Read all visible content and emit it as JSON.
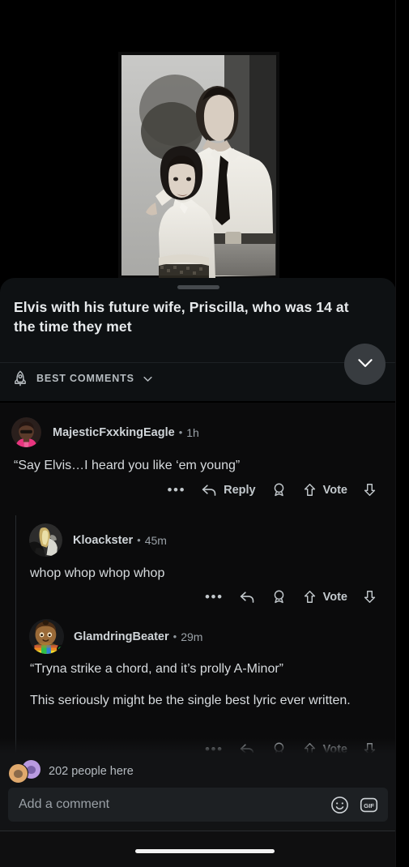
{
  "post": {
    "title": "Elvis with his future wife, Priscilla, who was 14 at the time they met",
    "media_alt": "Black and white photo of Elvis Presley with young Priscilla",
    "grabber_name": "drag-handle"
  },
  "sort": {
    "label": "BEST COMMENTS",
    "icon": "rocket-icon",
    "chevron": "chevron-down-icon"
  },
  "collapse": {
    "icon": "chevron-down-icon",
    "label": "Collapse post"
  },
  "actions": {
    "overflow": "•••",
    "reply": "Reply",
    "vote": "Vote",
    "award_icon": "award-ribbon-icon",
    "upvote_icon": "upvote-arrow-icon",
    "downvote_icon": "downvote-arrow-icon",
    "reply_icon": "reply-arrow-icon"
  },
  "comments": [
    {
      "id": "comment-1",
      "username": "MajesticFxxkingEagle",
      "separator": "•",
      "age": "1h",
      "online": false,
      "avatar_colors": {
        "bg": "#2a1f1c",
        "skin": "#5a3a2a",
        "shirt": "#e8357f",
        "hair": "#241612"
      },
      "paragraphs": [
        "“Say Elvis…I heard you like ‘em young”"
      ],
      "show_reply_label": true,
      "show_vote_label": true
    },
    {
      "id": "comment-2",
      "username": "Kloackster",
      "separator": "•",
      "age": "45m",
      "online": false,
      "avatar_colors": {
        "bg": "#2c2c2c",
        "skin": "#c9b069",
        "shirt": "#d8d8d0",
        "hair": "#1a1a1a"
      },
      "paragraphs": [
        "whop whop whop whop"
      ],
      "show_reply_label": false,
      "show_vote_label": true
    },
    {
      "id": "comment-3",
      "username": "GlamdringBeater",
      "separator": "•",
      "age": "29m",
      "online": true,
      "avatar_colors": {
        "bg": "#191a1c",
        "skin": "#9a6a38",
        "shirt": "#35b84a",
        "hair": "#4a2d16"
      },
      "paragraphs": [
        "“Tryna strike a chord, and it’s prolly A-Minor”",
        "This seriously might be the single best lyric ever written."
      ],
      "show_reply_label": false,
      "show_vote_label": true
    }
  ],
  "bottom": {
    "presence_text": "202 people here",
    "composer_placeholder": "Add a comment",
    "composer_value": "",
    "emoji_icon": "smiley-face-icon",
    "gif_icon": "gif-icon",
    "gif_label": "GIF"
  },
  "colors": {
    "sheet_bg": "#0e1113",
    "list_bg": "#0b0b0c",
    "bottom_bg": "#121315",
    "accent_online": "#15c23b",
    "text_primary": "#d7dbde",
    "text_secondary": "#9aa1a7"
  }
}
